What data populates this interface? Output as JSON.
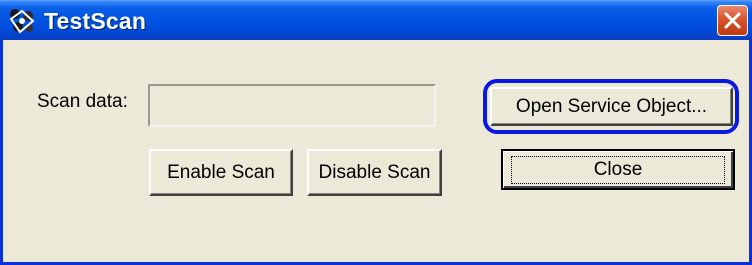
{
  "window": {
    "title": "TestScan",
    "icon": "testscan-app-icon",
    "close_icon": "close-icon"
  },
  "form": {
    "scan_label": "Scan data:",
    "scan_value": ""
  },
  "buttons": {
    "enable": "Enable Scan",
    "disable": "Disable Scan",
    "open": "Open Service Object...",
    "close": "Close"
  },
  "colors": {
    "titlebar": "#0054e3",
    "window_bg": "#ece9d8",
    "close_button": "#d7542f",
    "annotation_highlight": "#0a18e6"
  }
}
